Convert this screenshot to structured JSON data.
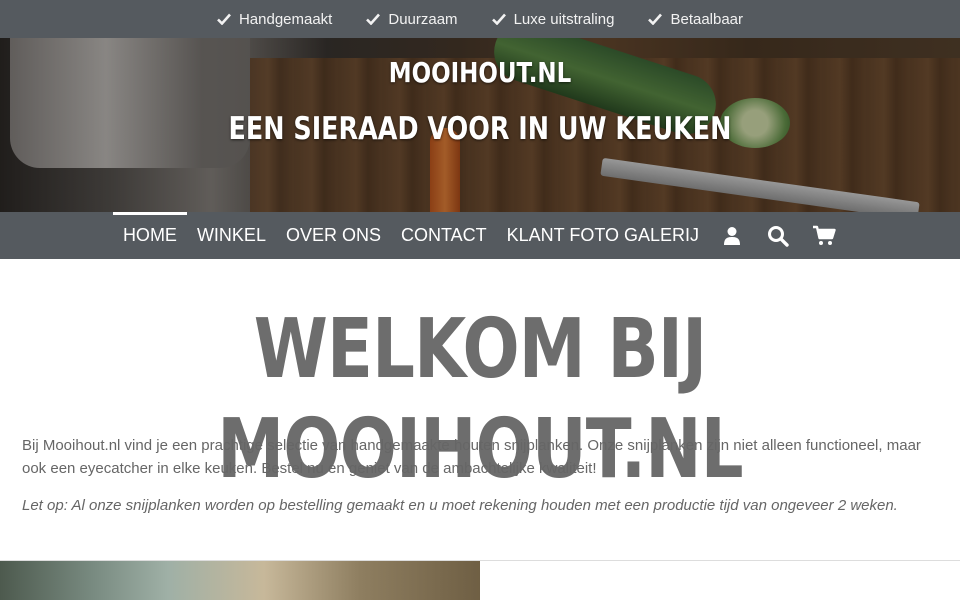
{
  "usps": [
    {
      "label": "Handgemaakt",
      "icon": "check-icon"
    },
    {
      "label": "Duurzaam",
      "icon": "check-icon"
    },
    {
      "label": "Luxe uitstraling",
      "icon": "check-icon"
    },
    {
      "label": "Betaalbaar",
      "icon": "check-icon"
    }
  ],
  "hero": {
    "site_name": "MOOIHOUT.NL",
    "tagline": "EEN SIERAAD VOOR IN UW KEUKEN"
  },
  "nav": {
    "items": [
      {
        "label": "HOME",
        "active": true
      },
      {
        "label": "WINKEL"
      },
      {
        "label": "OVER ONS"
      },
      {
        "label": "CONTACT"
      },
      {
        "label": "KLANT FOTO GALERIJ"
      }
    ],
    "icons": [
      "user-icon",
      "search-icon",
      "cart-icon"
    ]
  },
  "main": {
    "heading": "WELKOM BIJ MOOIHOUT.NL",
    "intro": "Bij Mooihout.nl vind je een prachtige selectie van handgemaakte houten snijplanken. Onze snijplanken zijn niet alleen functioneel, maar ook een eyecatcher in elke keuken. Bestel nu en geniet van de ambachtelijke kwaliteit!",
    "note": "Let op: Al onze snijplanken worden op bestelling gemaakt en u moet rekening houden met een productie tijd van ongeveer 2 weken."
  },
  "colors": {
    "bar_background": "#555a5f",
    "heading_color": "#6d6d6d",
    "text_color": "#666666"
  }
}
